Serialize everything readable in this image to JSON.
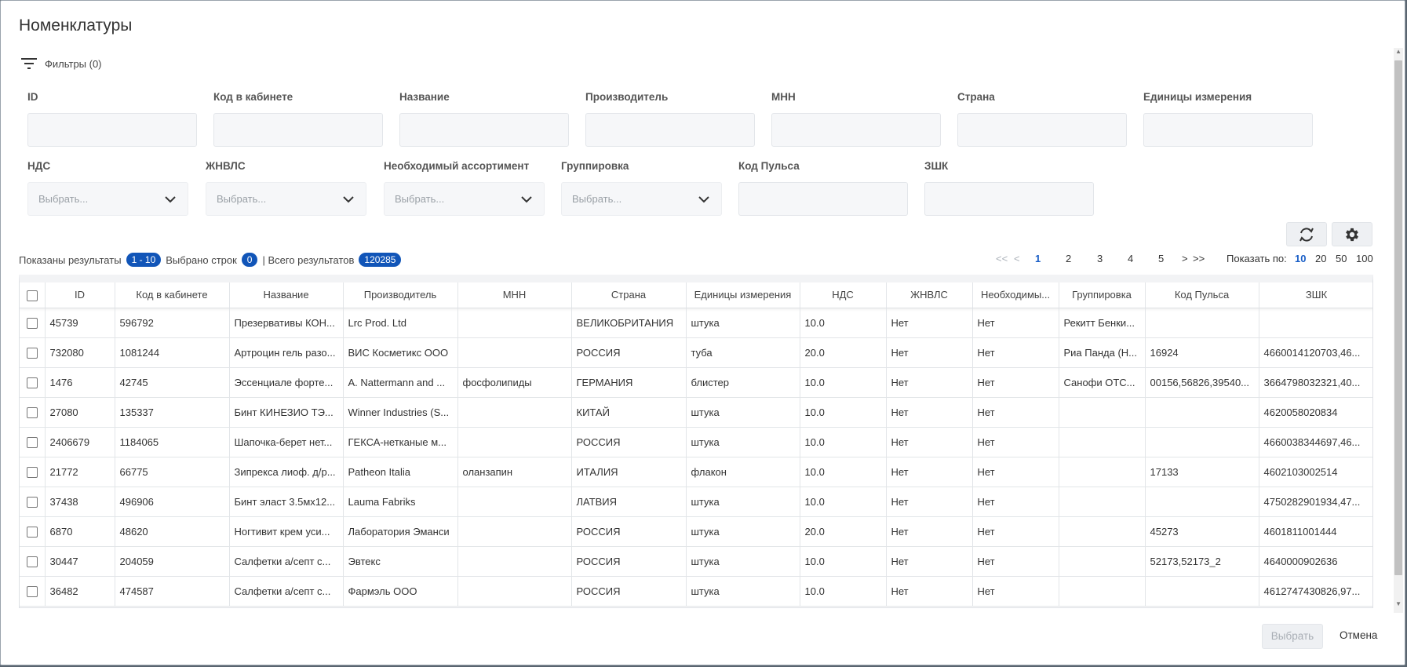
{
  "dialog": {
    "title": "Номенклатуры",
    "filters_label": "Фильтры (0)"
  },
  "filters_row1": [
    {
      "label": "ID",
      "value": ""
    },
    {
      "label": "Код в кабинете",
      "value": ""
    },
    {
      "label": "Название",
      "value": ""
    },
    {
      "label": "Производитель",
      "value": ""
    },
    {
      "label": "МНН",
      "value": ""
    },
    {
      "label": "Страна",
      "value": ""
    },
    {
      "label": "Единицы измерения",
      "value": ""
    }
  ],
  "filters_row2": {
    "nds": {
      "label": "НДС",
      "placeholder": "Выбрать..."
    },
    "zhnvls": {
      "label": "ЖНВЛС",
      "placeholder": "Выбрать..."
    },
    "assortment": {
      "label": "Необходимый ассортимент",
      "placeholder": "Выбрать..."
    },
    "grouping": {
      "label": "Группировка",
      "placeholder": "Выбрать..."
    },
    "puls_code": {
      "label": "Код Пульса",
      "value": ""
    },
    "zshk": {
      "label": "ЗШК",
      "value": ""
    }
  },
  "toolbar": {
    "refresh_icon": "refresh-icon",
    "settings_icon": "gear-icon"
  },
  "stats": {
    "shown_label": "Показаны результаты",
    "shown_range": "1 - 10",
    "selected_label": "Выбрано строк",
    "selected_count": "0",
    "total_label": "| Всего результатов",
    "total_count": "120285"
  },
  "pagination": {
    "first": "<<",
    "prev": "<",
    "pages": [
      "1",
      "2",
      "3",
      "4",
      "5"
    ],
    "next": ">",
    "last": ">>",
    "page_size_label": "Показать по:",
    "page_sizes": [
      "10",
      "20",
      "50",
      "100"
    ],
    "current_page": "1",
    "current_page_size": "10"
  },
  "table": {
    "columns": [
      "ID",
      "Код в кабинете",
      "Название",
      "Производитель",
      "МНН",
      "Страна",
      "Единицы измерения",
      "НДС",
      "ЖНВЛС",
      "Необходимы...",
      "Группировка",
      "Код Пульса",
      "ЗШК"
    ],
    "rows": [
      [
        "45739",
        "596792",
        "Презервативы КОН...",
        "Lrc Prod. Ltd",
        "",
        "ВЕЛИКОБРИТАНИЯ",
        "штука",
        "10.0",
        "Нет",
        "Нет",
        "Рекитт Бенки...",
        "",
        ""
      ],
      [
        "732080",
        "1081244",
        "Артроцин гель разо...",
        "ВИС Косметикс ООО",
        "",
        "РОССИЯ",
        "туба",
        "20.0",
        "Нет",
        "Нет",
        "Риа Панда (Н...",
        "16924",
        "4660014120703,46..."
      ],
      [
        "1476",
        "42745",
        "Эссенциале форте...",
        "A. Nattermann and ...",
        "фосфолипиды",
        "ГЕРМАНИЯ",
        "блистер",
        "10.0",
        "Нет",
        "Нет",
        "Санофи ОТС...",
        "00156,56826,39540...",
        "3664798032321,40..."
      ],
      [
        "27080",
        "135337",
        "Бинт КИНЕЗИО ТЭ...",
        "Winner Industries (S...",
        "",
        "КИТАЙ",
        "штука",
        "10.0",
        "Нет",
        "Нет",
        "",
        "",
        "4620058020834"
      ],
      [
        "2406679",
        "1184065",
        "Шапочка-берет нет...",
        "ГЕКСА-нетканые м...",
        "",
        "РОССИЯ",
        "штука",
        "10.0",
        "Нет",
        "Нет",
        "",
        "",
        "4660038344697,46..."
      ],
      [
        "21772",
        "66775",
        "Зипрекса лиоф. д/р...",
        "Patheon Italia",
        "оланзапин",
        "ИТАЛИЯ",
        "флакон",
        "10.0",
        "Нет",
        "Нет",
        "",
        "17133",
        "4602103002514"
      ],
      [
        "37438",
        "496906",
        "Бинт эласт 3.5мх12...",
        "Lauma Fabriks",
        "",
        "ЛАТВИЯ",
        "штука",
        "10.0",
        "Нет",
        "Нет",
        "",
        "",
        "4750282901934,47..."
      ],
      [
        "6870",
        "48620",
        "Ногтивит крем уси...",
        "Лаборатория Эманси",
        "",
        "РОССИЯ",
        "штука",
        "20.0",
        "Нет",
        "Нет",
        "",
        "45273",
        "4601811001444"
      ],
      [
        "30447",
        "204059",
        "Салфетки а/септ с...",
        "Эвтекс",
        "",
        "РОССИЯ",
        "штука",
        "10.0",
        "Нет",
        "Нет",
        "",
        "52173,52173_2",
        "4640000902636"
      ],
      [
        "36482",
        "474587",
        "Салфетки а/септ с...",
        "Фармэль ООО",
        "",
        "РОССИЯ",
        "штука",
        "10.0",
        "Нет",
        "Нет",
        "",
        "",
        "4612747430826,97..."
      ]
    ]
  },
  "footer": {
    "select_label": "Выбрать",
    "cancel_label": "Отмена"
  }
}
